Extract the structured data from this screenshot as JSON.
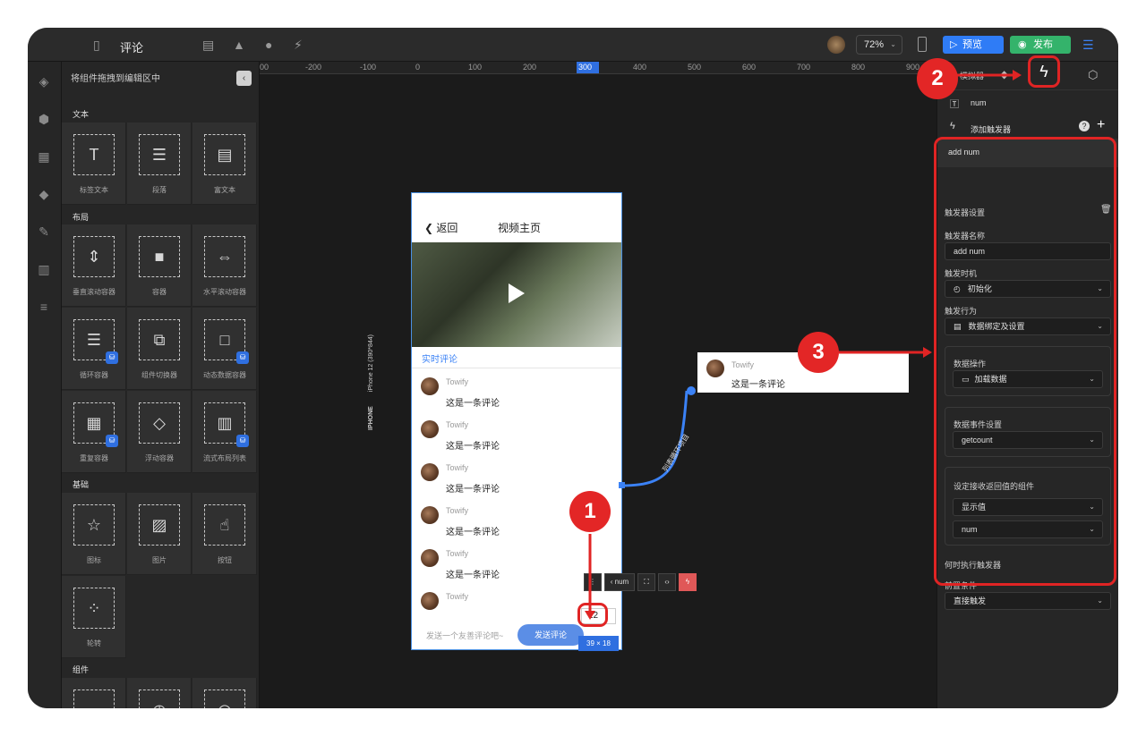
{
  "topbar": {
    "title": "评论",
    "zoom": "72%",
    "preview_label": "预览",
    "publish_label": "发布"
  },
  "components_panel": {
    "header": "将组件拖拽到编辑区中",
    "sections": {
      "text": "文本",
      "layout": "布局",
      "basic": "基础",
      "components": "组件"
    },
    "text_items": [
      "标签文本",
      "段落",
      "富文本"
    ],
    "layout_items": [
      "垂直滚动容器",
      "容器",
      "水平滚动容器",
      "循环容器",
      "组件切换器",
      "动态数据容器",
      "重复容器",
      "浮动容器",
      "流式布局列表"
    ],
    "basic_items": [
      "图标",
      "图片",
      "按钮",
      "轮转"
    ]
  },
  "ruler": {
    "labels": [
      "00",
      "-200",
      "-100",
      "0",
      "100",
      "200",
      "300",
      "400",
      "500",
      "600",
      "700",
      "800",
      "900"
    ]
  },
  "phone": {
    "device_label_bold": "IPHONE",
    "device_label": "iPhone 12 (390*844)",
    "back": "返回",
    "title": "视频主页",
    "tab": "实时评论",
    "comments": [
      {
        "name": "Towify",
        "text": "这是一条评论"
      },
      {
        "name": "Towify",
        "text": "这是一条评论"
      },
      {
        "name": "Towify",
        "text": "这是一条评论"
      },
      {
        "name": "Towify",
        "text": "这是一条评论"
      },
      {
        "name": "Towify",
        "text": "这是一条评论"
      },
      {
        "name": "Towify",
        "text": ""
      }
    ],
    "input_placeholder": "发送一个友善评论吧~",
    "send_label": "发送评论",
    "num_value": "12",
    "size_tag": "39 × 18"
  },
  "float_toolbar": {
    "num_label": "num"
  },
  "link": {
    "label": "列表循环项目"
  },
  "list_preview": {
    "name": "Towify",
    "text": "这是一条评论"
  },
  "right_panel": {
    "tab_simulator": "模拟器",
    "component_name": "num",
    "add_trigger": "添加触发器",
    "trigger_title": "add num",
    "trigger_settings": "触发器设置",
    "trigger_name_label": "触发器名称",
    "trigger_name_value": "add num",
    "trigger_time_label": "触发时机",
    "trigger_time_value": "初始化",
    "trigger_action_label": "触发行为",
    "trigger_action_value": "数据绑定及设置",
    "data_op_label": "数据操作",
    "data_op_value": "加载数据",
    "data_event_label": "数据事件设置",
    "data_event_value": "getcount",
    "return_comp_label": "设定接收返回值的组件",
    "return_comp_value1": "显示值",
    "return_comp_value2": "num",
    "when_label": "何时执行触发器",
    "precondition_label": "前置条件",
    "precondition_value": "直接触发"
  },
  "markers": [
    "1",
    "2",
    "3"
  ],
  "colors": {
    "accent_blue": "#2f7cf6",
    "publish_green": "#34b36b",
    "annotation_red": "#e02424",
    "link_blue": "#3b82f6"
  }
}
